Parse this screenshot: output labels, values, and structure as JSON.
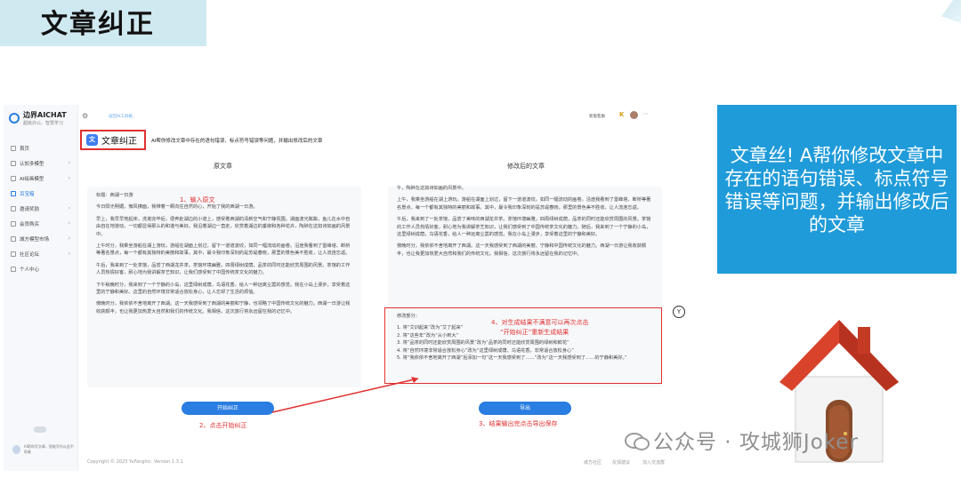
{
  "slide": {
    "title": "文章纠正",
    "callout": "文章丝! A帮你修改文章中存在的语句错误、标点符号错误等问题，并输出修改后的文章",
    "watermark": "公众号 · 攻城狮Joker",
    "accent": "#1f9bd9",
    "annotation_color": "#e03030"
  },
  "app": {
    "brand": "边界AICHAT",
    "brand_sub": "超级办公、智慧学习",
    "topbar_hint": "返回AI工具箱",
    "topbar_version": "新版客服",
    "topbar_k": "K",
    "nav": [
      {
        "label": "首页",
        "icon": "home-icon",
        "arrow": ""
      },
      {
        "label": "认知多模型 ",
        "icon": "chat-icon",
        "arrow": "›"
      },
      {
        "label": "AI绘画模型 ",
        "icon": "paint-icon",
        "arrow": "›"
      },
      {
        "label": "百宝箱",
        "icon": "toolbox-icon",
        "arrow": "",
        "active": true
      },
      {
        "label": "邀请奖励 ",
        "icon": "gift-icon",
        "arrow": "›"
      },
      {
        "label": "会员购买",
        "icon": "vip-icon",
        "arrow": "›"
      },
      {
        "label": "城方模型市场",
        "icon": "market-icon",
        "arrow": "›"
      },
      {
        "label": "社区论坛",
        "icon": "forum-icon",
        "arrow": "›"
      },
      {
        "label": "个人中心",
        "icon": "user-icon",
        "arrow": ""
      }
    ],
    "sidebar_footer": "AI帮你写文章，智能写作从此不再难",
    "mode_label": "文章纠正",
    "mode_icon": "文",
    "mode_desc": "AI帮你修改文章中存在的语句错误、标点符号错误等问题，并输出修改后的文章",
    "col_left": "原文章",
    "col_right": "修改后的文章",
    "left_paragraphs": [
      "标题：西湖一日游",
      "今日阳光明媚，微风拂面，我带着一颗向往自然的心，开始了我的西湖一日游。",
      "早上，我早早地起床，洗漱完毕后，便奔赴湖边的小道上，感受着西湖的清新空气和宁静氛围。湖面波光粼粼，鱼儿在水中自由自在地游动，一切都显得那么的和谐与美好。我沿着湖边一直走，欣赏着湖边的垂柳和各种花卉，陶醉在这如诗如画的风景中。",
      "上午时分，我乘坐游船在湖上游玩，游船在湖面上划过，留下一道道波纹，如同一幅流动的画卷。沿途我看到了雷峰塔、断桥等著名景点，每一个都有其独特的美丽和故事。其中，最令我印象深刻的是苏堤春晓，那里的景色美不胜收，让人流连忘返。",
      "午后，我来到了一处茶馆，品尝了西湖龙井茶。茶馆环境幽雅，四周绿树成荫，品茶的同时还能欣赏周围的风景。茶馆的工作人员热情好客，耐心地为我讲解茶艺知识，让我们感受到了中国传统茶文化的魅力。",
      "下午稍晚时分，我来到了一个宁静的小岛，这里绿树成荫，鸟语花香，给人一种远离尘嚣的感觉。我在小岛上漫步，享受着这里的宁静和美好。这里的自然环境非常适合放松身心，让人忘却了生活的烦恼。",
      "傍晚时分，我依依不舍地离开了西湖。这一天我感受到了西湖的美丽和宁静，也领略了中国传统文化的魅力。西湖一日游让我收获颇丰，也让我更加热爱大自然和我们的传统文化。我相信，这次旅行将永远留在我的记忆中。"
    ],
    "right_paragraphs": [
      "午，陶醉在这如诗如画的风景中。",
      "上午，我乘坐游船在湖上游玩。游船在湖面上划过，留下一道道波纹，如同一幅流动的画卷。沿途我看到了雷峰塔、断桥等著名景点，每一个都有其独特的美丽和故事。其中，最令我印象深刻的是苏堤春晓，那里的景色美不胜收，让人流连忘返。",
      "午后，我来到了一处茶馆，品尝了美味的西湖龙井茶。茶馆环境幽雅，四周绿树成荫，品茶的同时还能欣赏周围的风景。茶馆的工作人员热情好客，耐心地为我讲解茶艺知识，让我们感受到了中国传统茶文化的魅力。随后，我来到了一个宁静的小岛，这里绿树成荫，鸟语花香，给人一种远离尘嚣的感觉。我在小岛上漫步，享受着这里的宁静和美好。",
      "傍晚时分，我依依不舍地离开了西湖。这一天我感受到了西湖的美丽、宁静和中国传统文化的魅力。西湖一日游让我收获颇丰，也让我更加热爱大自然和我们的传统文化。我相信，这次旅行将永远留在我的记忆中。"
    ],
    "changes_title": "修改部分：",
    "changes": [
      "1. 将“艾训起来”改为“艾了起来”",
      "2. 将“这些年”改为“从小到大”",
      "3. 将“品茶的同时还能欣赏周围的风景”改为“品茶的同时还能欣赏周围的绿树和鲜花”",
      "4. 将“自然环境非常适合放松身心”改为“这里绿树成荫、鸟语花香，非常适合放松身心”",
      "5. 将“我依依不舍地离开了西湖”后添加一句“这一天我感受到了……”改为“这一天我感受到了……的宁静和美好。”"
    ],
    "btn_start": "开始纠正",
    "btn_export": "导出",
    "footer_copyright": "Copyright © 2023 YuFangInc. Version 1.3.1",
    "footer_links": [
      "城方社区",
      "反馈建议",
      "加入交流群"
    ],
    "side_icon": "Y"
  },
  "annotations": {
    "step1": "1、输入原文",
    "step2": "2、点击开始纠正",
    "step3": "3、结果输出完点击导出保存",
    "step4_line1": "4、对生成结果不满意可以再次点击",
    "step4_line2": "“开始纠正”重新生成结果"
  }
}
